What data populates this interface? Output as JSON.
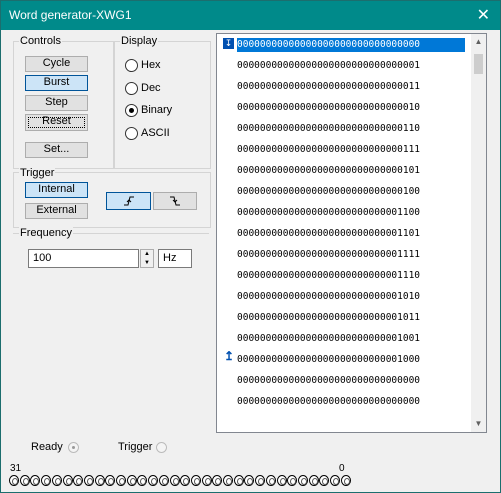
{
  "window": {
    "title": "Word generator-XWG1",
    "close": "✕"
  },
  "controls": {
    "label": "Controls",
    "cycle": "Cycle",
    "burst": "Burst",
    "step": "Step",
    "reset": "Reset",
    "set": "Set..."
  },
  "display": {
    "label": "Display",
    "options": [
      "Hex",
      "Dec",
      "Binary",
      "ASCII"
    ],
    "selected": "Binary"
  },
  "trigger": {
    "label": "Trigger",
    "internal": "Internal",
    "external": "External",
    "rising_icon": "rising-edge-icon",
    "falling_icon": "falling-edge-icon"
  },
  "frequency": {
    "label": "Frequency",
    "value": "100",
    "unit": "Hz"
  },
  "words": [
    "00000000000000000000000000000000",
    "00000000000000000000000000000001",
    "00000000000000000000000000000011",
    "00000000000000000000000000000010",
    "00000000000000000000000000000110",
    "00000000000000000000000000000111",
    "00000000000000000000000000000101",
    "00000000000000000000000000000100",
    "00000000000000000000000000001100",
    "00000000000000000000000000001101",
    "00000000000000000000000000001111",
    "00000000000000000000000000001110",
    "00000000000000000000000000001010",
    "00000000000000000000000000001011",
    "00000000000000000000000000001001",
    "00000000000000000000000000001000",
    "00000000000000000000000000000000",
    "00000000000000000000000000000000"
  ],
  "markers": {
    "start_icon": "start-cursor-icon",
    "end_icon": "final-position-icon"
  },
  "status": {
    "ready": "Ready",
    "trigger": "Trigger"
  },
  "bits": {
    "msb": "31",
    "lsb": "0",
    "count": 32
  }
}
